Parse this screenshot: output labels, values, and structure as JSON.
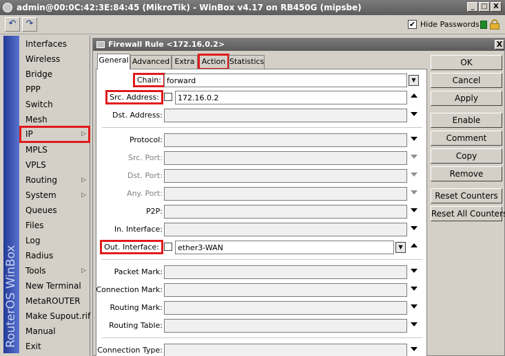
{
  "window": {
    "title": "admin@00:0C:42:3E:84:45 (MikroTik) - WinBox v4.17 on RB450G (mipsbe)",
    "minimize": "_",
    "maximize": "□",
    "close": "X"
  },
  "toolbar": {
    "undo": "↶",
    "redo": "↷",
    "hide_passwords_label": "Hide Passwords",
    "hide_passwords_checked": "✔"
  },
  "brand": "RouterOS WinBox",
  "menu": {
    "items": [
      {
        "label": "Interfaces",
        "arrow": ""
      },
      {
        "label": "Wireless",
        "arrow": ""
      },
      {
        "label": "Bridge",
        "arrow": ""
      },
      {
        "label": "PPP",
        "arrow": ""
      },
      {
        "label": "Switch",
        "arrow": ""
      },
      {
        "label": "Mesh",
        "arrow": ""
      },
      {
        "label": "IP",
        "arrow": "▷"
      },
      {
        "label": "MPLS",
        "arrow": ""
      },
      {
        "label": "VPLS",
        "arrow": ""
      },
      {
        "label": "Routing",
        "arrow": "▷"
      },
      {
        "label": "System",
        "arrow": "▷"
      },
      {
        "label": "Queues",
        "arrow": ""
      },
      {
        "label": "Files",
        "arrow": ""
      },
      {
        "label": "Log",
        "arrow": ""
      },
      {
        "label": "Radius",
        "arrow": ""
      },
      {
        "label": "Tools",
        "arrow": "▷"
      },
      {
        "label": "New Terminal",
        "arrow": ""
      },
      {
        "label": "MetaROUTER",
        "arrow": ""
      },
      {
        "label": "Make Supout.rif",
        "arrow": ""
      },
      {
        "label": "Manual",
        "arrow": ""
      },
      {
        "label": "Exit",
        "arrow": ""
      }
    ]
  },
  "dialog": {
    "title": "Firewall Rule <172.16.0.2>",
    "close": "X",
    "tabs": [
      "General",
      "Advanced",
      "Extra",
      "Action",
      "Statistics"
    ],
    "fields": {
      "chain": {
        "label": "Chain:",
        "value": "forward"
      },
      "src_address": {
        "label": "Src. Address:",
        "value": "172.16.0.2"
      },
      "dst_address": {
        "label": "Dst. Address:",
        "value": ""
      },
      "protocol": {
        "label": "Protocol:",
        "value": ""
      },
      "src_port": {
        "label": "Src. Port:",
        "value": ""
      },
      "dst_port": {
        "label": "Dst. Port:",
        "value": ""
      },
      "any_port": {
        "label": "Any. Port:",
        "value": ""
      },
      "p2p": {
        "label": "P2P:",
        "value": ""
      },
      "in_interface": {
        "label": "In. Interface:",
        "value": ""
      },
      "out_interface": {
        "label": "Out. Interface:",
        "value": "ether3-WAN"
      },
      "packet_mark": {
        "label": "Packet Mark:",
        "value": ""
      },
      "connection_mark": {
        "label": "Connection Mark:",
        "value": ""
      },
      "routing_mark": {
        "label": "Routing Mark:",
        "value": ""
      },
      "routing_table": {
        "label": "Routing Table:",
        "value": ""
      },
      "connection_type": {
        "label": "Connection Type:",
        "value": ""
      }
    },
    "buttons": [
      "OK",
      "Cancel",
      "Apply",
      "Enable",
      "Comment",
      "Copy",
      "Remove",
      "Reset Counters",
      "Reset All Counters"
    ],
    "dropdown_glyph": "▼"
  },
  "colors": {
    "highlight": "#e01a1a",
    "brand_strip": "#2b45a8"
  }
}
